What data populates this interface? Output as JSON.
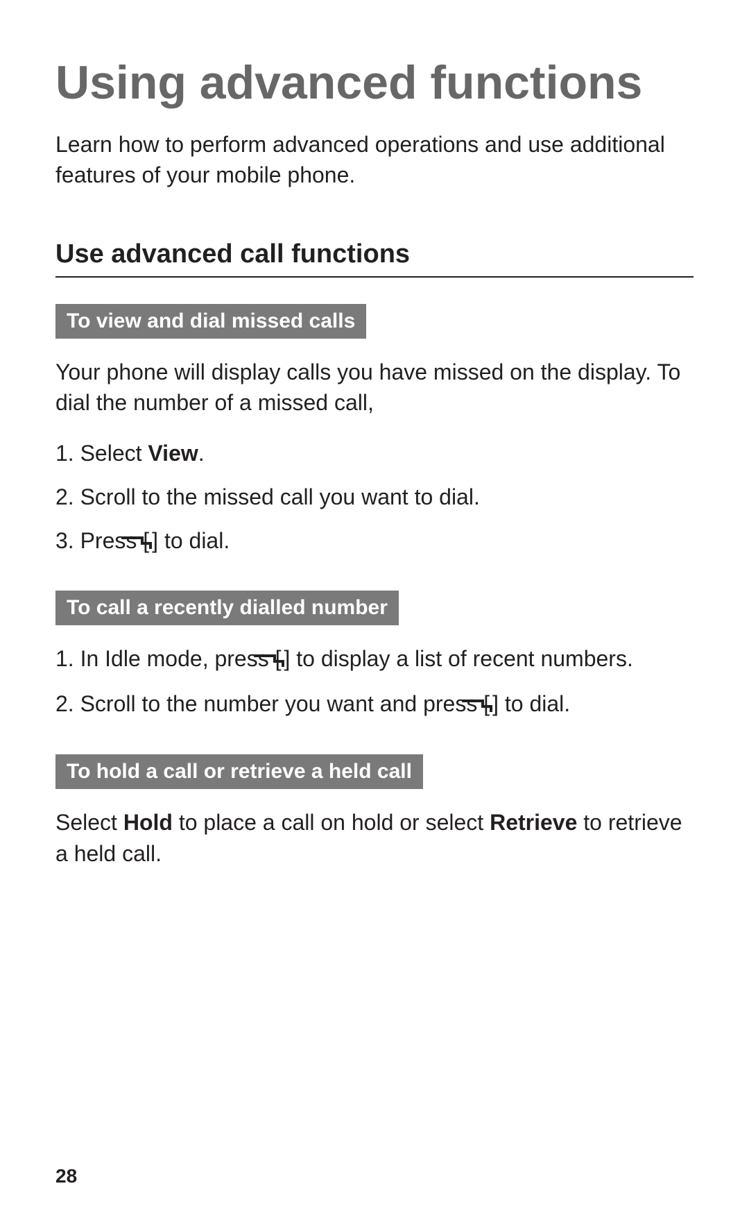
{
  "title": "Using advanced functions",
  "intro": "Learn how to perform advanced operations and use additional features of your mobile phone.",
  "section_title": "Use advanced call functions",
  "sub1": {
    "heading": "To view and dial missed calls",
    "text": "Your phone will display calls you have missed on the display. To dial the number of a missed call,",
    "steps": {
      "s1_pre": "Select ",
      "s1_bold": "View",
      "s1_post": ".",
      "s2": "Scroll to the missed call you want to dial.",
      "s3_pre": "Press [",
      "s3_post": "] to dial."
    }
  },
  "sub2": {
    "heading": "To call a recently dialled number",
    "steps": {
      "s1_pre": "In Idle mode, press [",
      "s1_post": "] to display a list of recent numbers.",
      "s2_pre": "Scroll to the number you want and press [",
      "s2_post": "] to dial."
    }
  },
  "sub3": {
    "heading": "To hold a call or retrieve a held call",
    "text_pre": "Select ",
    "text_b1": "Hold",
    "text_mid": " to place a call on hold or select ",
    "text_b2": "Retrieve",
    "text_post": " to retrieve a held call."
  },
  "page_number": "28"
}
